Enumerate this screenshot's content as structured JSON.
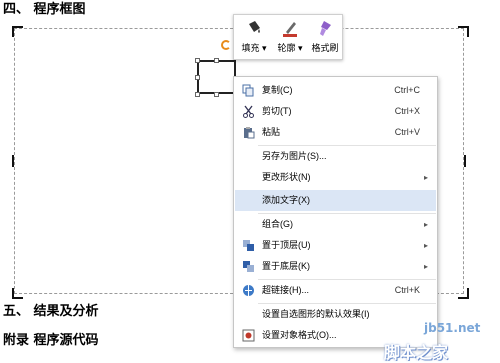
{
  "document": {
    "heading_top": "四、  程序框图",
    "heading_bottom1": "五、  结果及分析",
    "heading_bottom2": "附录  程序源代码"
  },
  "toolbar": {
    "fill_label": "填充",
    "outline_label": "轮廓",
    "format_painter_label": "格式刷",
    "icons": [
      "fill-bucket-icon",
      "outline-pen-icon",
      "format-brush-icon"
    ]
  },
  "context_menu": {
    "items": [
      {
        "label": "复制(C)",
        "shortcut": "Ctrl+C",
        "icon": "copy-icon"
      },
      {
        "label": "剪切(T)",
        "shortcut": "Ctrl+X",
        "icon": "cut-icon"
      },
      {
        "label": "粘贴",
        "shortcut": "Ctrl+V",
        "icon": "paste-icon"
      },
      {
        "label": "另存为图片(S)...",
        "shortcut": "",
        "icon": ""
      },
      {
        "label": "更改形状(N)",
        "shortcut": "",
        "icon": "",
        "submenu": true
      },
      {
        "label": "添加文字(X)",
        "shortcut": "",
        "icon": "",
        "highlighted": true
      },
      {
        "label": "组合(G)",
        "shortcut": "",
        "icon": "",
        "submenu": true
      },
      {
        "label": "置于顶层(U)",
        "shortcut": "",
        "icon": "bring-to-front-icon",
        "submenu": true
      },
      {
        "label": "置于底层(K)",
        "shortcut": "",
        "icon": "send-to-back-icon",
        "submenu": true
      },
      {
        "label": "超链接(H)...",
        "shortcut": "Ctrl+K",
        "icon": "hyperlink-icon"
      },
      {
        "label": "设置自选图形的默认效果(I)",
        "shortcut": "",
        "icon": ""
      },
      {
        "label": "设置对象格式(O)...",
        "shortcut": "",
        "icon": "format-object-icon"
      }
    ],
    "highlight_color": "#dbe6f5"
  },
  "watermark": {
    "line1": "jb51.net",
    "line2": "脚本之家"
  }
}
